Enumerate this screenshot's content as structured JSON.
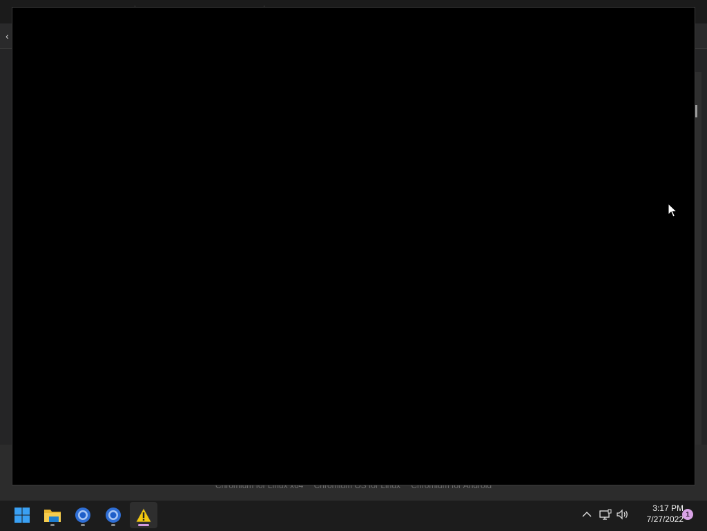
{
  "background_page": {
    "footer_links": [
      "Chromium for Linux x64",
      "Chromium OS for Linux",
      "Chromium for Android"
    ]
  },
  "taskbar": {
    "apps": [
      {
        "name": "start",
        "icon": "windows-start-icon"
      },
      {
        "name": "file-explorer",
        "icon": "folder-icon"
      },
      {
        "name": "chromium-1",
        "icon": "chromium-icon"
      },
      {
        "name": "chromium-2",
        "icon": "chromium-icon"
      },
      {
        "name": "warning-app",
        "icon": "warning-icon",
        "active": true
      }
    ],
    "tray": {
      "icons": [
        "chevron-up-icon",
        "network-icon",
        "volume-icon"
      ],
      "time": "3:17 PM",
      "date": "7/27/2022",
      "notification_count": "1"
    },
    "colors": {
      "accent": "#d9a3e6",
      "start": "#3aa0f3"
    }
  }
}
